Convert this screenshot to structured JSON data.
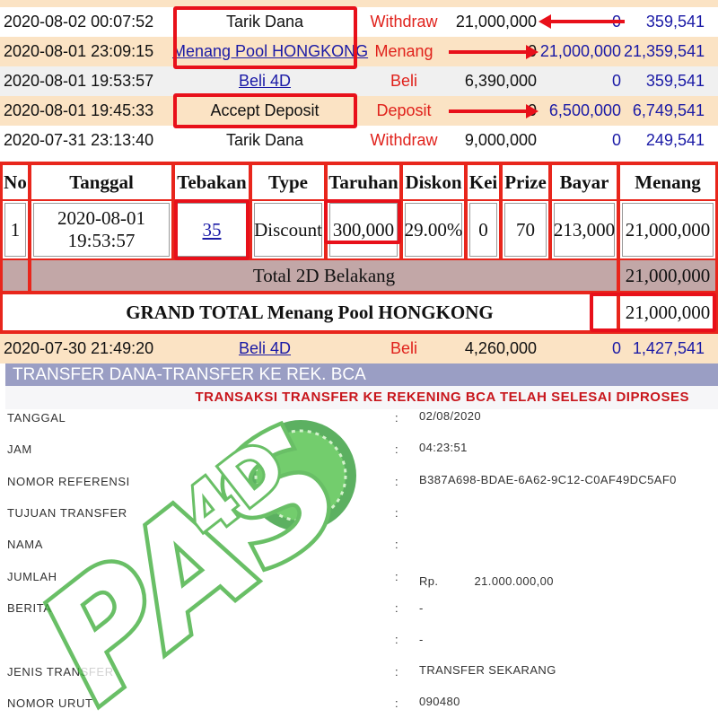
{
  "transactions": [
    {
      "date": "2020-08-02 00:07:52",
      "desc": "Tarik Dana",
      "type": "Withdraw",
      "amount": "21,000,000",
      "credit": "0",
      "balance": "359,541"
    },
    {
      "date": "2020-08-01 23:09:15",
      "desc": "Menang Pool HONGKONG",
      "type": "Menang",
      "amount": "0",
      "credit": "21,000,000",
      "balance": "21,359,541"
    },
    {
      "date": "2020-08-01 19:53:57",
      "desc": "Beli 4D",
      "type": "Beli",
      "amount": "6,390,000",
      "credit": "0",
      "balance": "359,541"
    },
    {
      "date": "2020-08-01 19:45:33",
      "desc": "Accept Deposit",
      "type": "Deposit",
      "amount": "0",
      "credit": "6,500,000",
      "balance": "6,749,541"
    },
    {
      "date": "2020-07-31 23:13:40",
      "desc": "Tarik Dana",
      "type": "Withdraw",
      "amount": "9,000,000",
      "credit": "0",
      "balance": "249,541"
    }
  ],
  "bet_table": {
    "headers": [
      "No",
      "Tanggal",
      "Tebakan",
      "Type",
      "Taruhan",
      "Diskon",
      "Kei",
      "Prize",
      "Bayar",
      "Menang"
    ],
    "row": {
      "no": "1",
      "date_line1": "2020-08-01",
      "date_line2": "19:53:57",
      "guess": "35",
      "type": "Discount",
      "bet": "300,000",
      "discount": "29.00%",
      "kei": "0",
      "prize": "70",
      "pay": "213,000",
      "win": "21,000,000"
    },
    "total_label": "Total 2D Belakang",
    "total_value": "21,000,000",
    "grand_total_label": "GRAND TOTAL  Menang Pool HONGKONG",
    "grand_total_value": "21,000,000"
  },
  "after_row": {
    "date": "2020-07-30 21:49:20",
    "desc": "Beli 4D",
    "type": "Beli",
    "amount": "4,260,000",
    "credit": "0",
    "balance": "1,427,541"
  },
  "transfer": {
    "title": "TRANSFER DANA-TRANSFER KE REK. BCA",
    "status": "TRANSAKSI TRANSFER KE REKENING BCA TELAH SELESAI DIPROSES",
    "fields": [
      {
        "label": "TANGGAL",
        "value": "02/08/2020"
      },
      {
        "label": "JAM",
        "value": "04:23:51"
      },
      {
        "label": "NOMOR REFERENSI",
        "value": "B387A698-BDAE-6A62-9C12-C0AF49DC5AF0"
      },
      {
        "label": "TUJUAN TRANSFER",
        "value": ""
      },
      {
        "label": "NAMA",
        "value": ""
      },
      {
        "label": "JUMLAH",
        "value": "Rp.          21.000.000,00"
      },
      {
        "label": "BERITA",
        "value": "-"
      },
      {
        "label": "",
        "value": "-"
      },
      {
        "label": "JENIS TRANSFER",
        "value": "TRANSFER SEKARANG"
      },
      {
        "label": "NOMOR URUT",
        "value": "090480"
      }
    ]
  },
  "watermark": {
    "text": "PAS4D",
    "color": "#3fae3c"
  },
  "colors": {
    "row_alt": "#fbe3c4",
    "row_grey": "#f0f0f0",
    "red": "#e8101a",
    "blue": "#1a1aa6",
    "header_purple": "#9a9ec4"
  }
}
